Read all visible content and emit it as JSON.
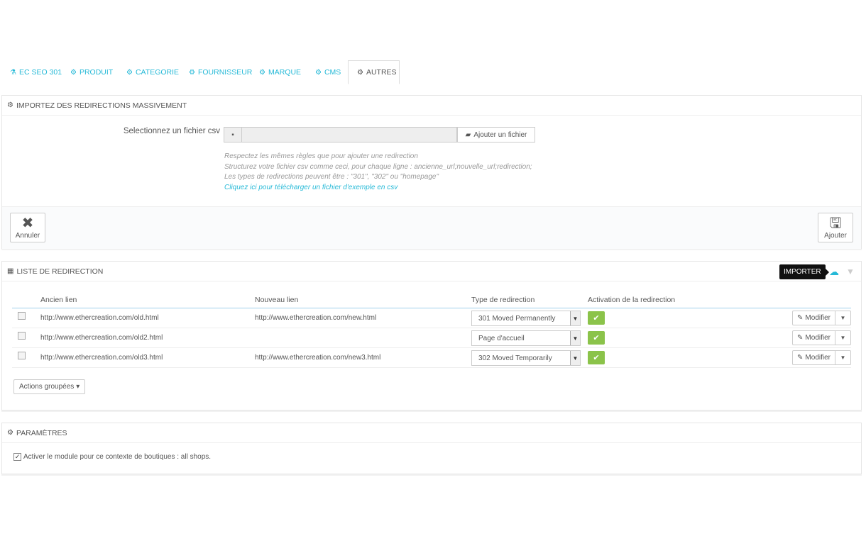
{
  "tabs": [
    {
      "label": "EC SEO 301",
      "icon": "flask-icon"
    },
    {
      "label": "PRODUIT",
      "icon": "cogs-icon"
    },
    {
      "label": "CATEGORIE",
      "icon": "cogs-icon"
    },
    {
      "label": "FOURNISSEUR",
      "icon": "cogs-icon"
    },
    {
      "label": "MARQUE",
      "icon": "cogs-icon"
    },
    {
      "label": "CMS",
      "icon": "cogs-icon"
    },
    {
      "label": "AUTRES",
      "icon": "cogs-icon",
      "active": true
    }
  ],
  "import_panel": {
    "title": "IMPORTEZ DES REDIRECTIONS MASSIVEMENT",
    "file_label": "Selectionnez un fichier csv",
    "file_button": "Ajouter un fichier",
    "help_lines": [
      "Respectez les mêmes règles que pour ajouter une redirection",
      "Structurez votre fichier csv comme ceci, pour chaque ligne : ancienne_url;nouvelle_url;redirection;",
      "Les types de redirections peuvent être : \"301\", \"302\" ou \"homepage\""
    ],
    "help_link": "Cliquez ici pour télécharger un fichier d'exemple en csv",
    "cancel_label": "Annuler",
    "add_label": "Ajouter"
  },
  "list_panel": {
    "title": "LISTE DE REDIRECTION",
    "tooltip": "IMPORTER",
    "columns": [
      "Ancien lien",
      "Nouveau lien",
      "Type de redirection",
      "Activation de la redirection"
    ],
    "rows": [
      {
        "old": "http://www.ethercreation.com/old.html",
        "new": "http://www.ethercreation.com/new.html",
        "type": "301 Moved Permanently",
        "edit": "Modifier"
      },
      {
        "old": "http://www.ethercreation.com/old2.html",
        "new": "",
        "type": "Page d'accueil",
        "edit": "Modifier"
      },
      {
        "old": "http://www.ethercreation.com/old3.html",
        "new": "http://www.ethercreation.com/new3.html",
        "type": "302 Moved Temporarily",
        "edit": "Modifier"
      }
    ],
    "bulk_actions": "Actions groupées"
  },
  "params_panel": {
    "title": "PARAMÈTRES",
    "checkbox_label": "Activer le module pour ce contexte de boutiques : all shops."
  },
  "colors": {
    "accent": "#25b9d7",
    "success": "#8bc34a"
  }
}
